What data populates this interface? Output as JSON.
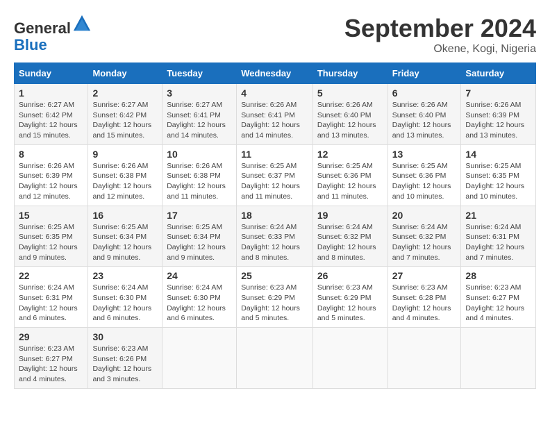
{
  "header": {
    "logo_line1": "General",
    "logo_line2": "Blue",
    "month_title": "September 2024",
    "location": "Okene, Kogi, Nigeria"
  },
  "days_of_week": [
    "Sunday",
    "Monday",
    "Tuesday",
    "Wednesday",
    "Thursday",
    "Friday",
    "Saturday"
  ],
  "weeks": [
    [
      {
        "day": "1",
        "sunrise": "6:27 AM",
        "sunset": "6:42 PM",
        "daylight": "Daylight: 12 hours and 15 minutes."
      },
      {
        "day": "2",
        "sunrise": "6:27 AM",
        "sunset": "6:42 PM",
        "daylight": "Daylight: 12 hours and 15 minutes."
      },
      {
        "day": "3",
        "sunrise": "6:27 AM",
        "sunset": "6:41 PM",
        "daylight": "Daylight: 12 hours and 14 minutes."
      },
      {
        "day": "4",
        "sunrise": "6:26 AM",
        "sunset": "6:41 PM",
        "daylight": "Daylight: 12 hours and 14 minutes."
      },
      {
        "day": "5",
        "sunrise": "6:26 AM",
        "sunset": "6:40 PM",
        "daylight": "Daylight: 12 hours and 13 minutes."
      },
      {
        "day": "6",
        "sunrise": "6:26 AM",
        "sunset": "6:40 PM",
        "daylight": "Daylight: 12 hours and 13 minutes."
      },
      {
        "day": "7",
        "sunrise": "6:26 AM",
        "sunset": "6:39 PM",
        "daylight": "Daylight: 12 hours and 13 minutes."
      }
    ],
    [
      {
        "day": "8",
        "sunrise": "6:26 AM",
        "sunset": "6:39 PM",
        "daylight": "Daylight: 12 hours and 12 minutes."
      },
      {
        "day": "9",
        "sunrise": "6:26 AM",
        "sunset": "6:38 PM",
        "daylight": "Daylight: 12 hours and 12 minutes."
      },
      {
        "day": "10",
        "sunrise": "6:26 AM",
        "sunset": "6:38 PM",
        "daylight": "Daylight: 12 hours and 11 minutes."
      },
      {
        "day": "11",
        "sunrise": "6:25 AM",
        "sunset": "6:37 PM",
        "daylight": "Daylight: 12 hours and 11 minutes."
      },
      {
        "day": "12",
        "sunrise": "6:25 AM",
        "sunset": "6:36 PM",
        "daylight": "Daylight: 12 hours and 11 minutes."
      },
      {
        "day": "13",
        "sunrise": "6:25 AM",
        "sunset": "6:36 PM",
        "daylight": "Daylight: 12 hours and 10 minutes."
      },
      {
        "day": "14",
        "sunrise": "6:25 AM",
        "sunset": "6:35 PM",
        "daylight": "Daylight: 12 hours and 10 minutes."
      }
    ],
    [
      {
        "day": "15",
        "sunrise": "6:25 AM",
        "sunset": "6:35 PM",
        "daylight": "Daylight: 12 hours and 9 minutes."
      },
      {
        "day": "16",
        "sunrise": "6:25 AM",
        "sunset": "6:34 PM",
        "daylight": "Daylight: 12 hours and 9 minutes."
      },
      {
        "day": "17",
        "sunrise": "6:25 AM",
        "sunset": "6:34 PM",
        "daylight": "Daylight: 12 hours and 9 minutes."
      },
      {
        "day": "18",
        "sunrise": "6:24 AM",
        "sunset": "6:33 PM",
        "daylight": "Daylight: 12 hours and 8 minutes."
      },
      {
        "day": "19",
        "sunrise": "6:24 AM",
        "sunset": "6:32 PM",
        "daylight": "Daylight: 12 hours and 8 minutes."
      },
      {
        "day": "20",
        "sunrise": "6:24 AM",
        "sunset": "6:32 PM",
        "daylight": "Daylight: 12 hours and 7 minutes."
      },
      {
        "day": "21",
        "sunrise": "6:24 AM",
        "sunset": "6:31 PM",
        "daylight": "Daylight: 12 hours and 7 minutes."
      }
    ],
    [
      {
        "day": "22",
        "sunrise": "6:24 AM",
        "sunset": "6:31 PM",
        "daylight": "Daylight: 12 hours and 6 minutes."
      },
      {
        "day": "23",
        "sunrise": "6:24 AM",
        "sunset": "6:30 PM",
        "daylight": "Daylight: 12 hours and 6 minutes."
      },
      {
        "day": "24",
        "sunrise": "6:24 AM",
        "sunset": "6:30 PM",
        "daylight": "Daylight: 12 hours and 6 minutes."
      },
      {
        "day": "25",
        "sunrise": "6:23 AM",
        "sunset": "6:29 PM",
        "daylight": "Daylight: 12 hours and 5 minutes."
      },
      {
        "day": "26",
        "sunrise": "6:23 AM",
        "sunset": "6:29 PM",
        "daylight": "Daylight: 12 hours and 5 minutes."
      },
      {
        "day": "27",
        "sunrise": "6:23 AM",
        "sunset": "6:28 PM",
        "daylight": "Daylight: 12 hours and 4 minutes."
      },
      {
        "day": "28",
        "sunrise": "6:23 AM",
        "sunset": "6:27 PM",
        "daylight": "Daylight: 12 hours and 4 minutes."
      }
    ],
    [
      {
        "day": "29",
        "sunrise": "6:23 AM",
        "sunset": "6:27 PM",
        "daylight": "Daylight: 12 hours and 4 minutes."
      },
      {
        "day": "30",
        "sunrise": "6:23 AM",
        "sunset": "6:26 PM",
        "daylight": "Daylight: 12 hours and 3 minutes."
      },
      null,
      null,
      null,
      null,
      null
    ]
  ]
}
